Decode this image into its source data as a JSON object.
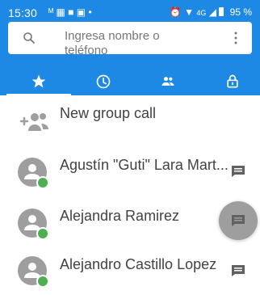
{
  "status_bar": {
    "time": "15:30",
    "battery_text": "95 %",
    "left_icons": [
      "signal-m-icon",
      "app-icon",
      "square-icon",
      "photo-icon",
      "dot-icon"
    ],
    "right_icons": [
      "alarm-icon",
      "wifi-icon",
      "4g-icon",
      "signal-icon",
      "battery-icon"
    ]
  },
  "search": {
    "placeholder": "Ingresa nombre o teléfono",
    "icon": "search-icon",
    "menu_icon": "more-vert-icon"
  },
  "tabs": [
    {
      "icon": "star-icon",
      "selected": true
    },
    {
      "icon": "clock-icon",
      "selected": false
    },
    {
      "icon": "group-icon",
      "selected": false
    },
    {
      "icon": "lock-icon",
      "selected": false
    }
  ],
  "list": {
    "new_group_call": "New group call",
    "contacts": [
      {
        "name": "Agustín \"Guti\" Lara Mart...",
        "status": "online"
      },
      {
        "name": "Alejandra Ramirez",
        "status": "online"
      },
      {
        "name": "Alejandro Castillo Lopez",
        "status": "online"
      }
    ]
  },
  "colors": {
    "primary": "#1e88e5",
    "status_online": "#4caf50",
    "avatar_bg": "#9e9e9e"
  }
}
